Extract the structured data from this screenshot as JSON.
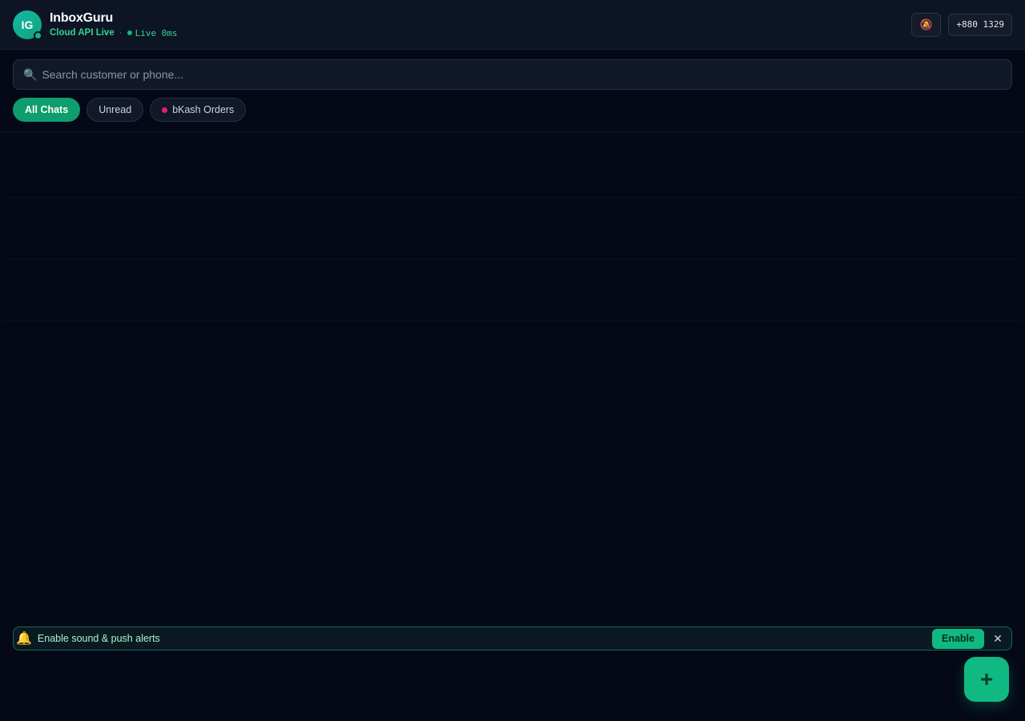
{
  "header": {
    "avatar_initials": "IG",
    "app_name": "InboxGuru",
    "api_status": "Cloud API Live",
    "separator": "·",
    "live_status": "Live 0ms",
    "mute_icon": "bell-slash-icon",
    "phone": "+880 1329"
  },
  "search": {
    "icon": "search-icon",
    "placeholder": "Search customer or phone..."
  },
  "filters": [
    {
      "label": "All Chats",
      "active": true
    },
    {
      "label": "Unread",
      "active": false
    },
    {
      "label": "bKash Orders",
      "active": false,
      "tag_color": "#e11d74"
    }
  ],
  "notification": {
    "icon": "bell-icon",
    "text": "Enable sound & push alerts",
    "enable_label": "Enable",
    "close_glyph": "✕"
  },
  "fab": {
    "glyph": "+"
  },
  "colors": {
    "accent": "#10b981",
    "background": "#050816",
    "header_bg": "#0d1424",
    "tag_bkash": "#e11d74"
  }
}
